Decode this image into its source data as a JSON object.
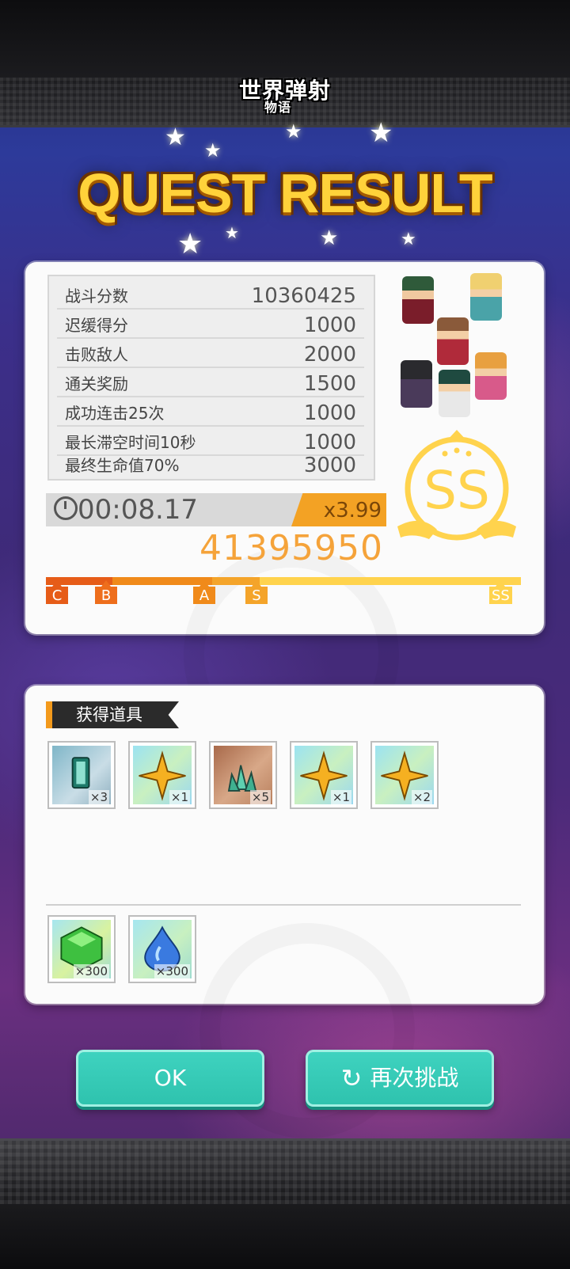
{
  "header": {
    "logo_text": "世界弹射",
    "logo_sub": "物语"
  },
  "title": "QUEST RESULT",
  "result": {
    "rows": [
      {
        "label": "战斗分数",
        "value": "10360425"
      },
      {
        "label": "迟缓得分",
        "value": "1000"
      },
      {
        "label": "击败敌人",
        "value": "2000"
      },
      {
        "label": "通关奖励",
        "value": "1500"
      },
      {
        "label": "成功连击25次",
        "value": "1000"
      },
      {
        "label": "最长滞空时间10秒",
        "value": "1000"
      },
      {
        "label": "最终生命值70%",
        "value": "3000"
      }
    ],
    "time": "00:08.17",
    "multiplier": "x3.99",
    "total": "41395950",
    "rank": "SS",
    "rank_marks": [
      "C",
      "B",
      "A",
      "S",
      "SS"
    ],
    "colors": {
      "orange": "#f3a224",
      "gold": "#ffd34d",
      "red": "#e65c18"
    }
  },
  "items": {
    "header": "获得道具",
    "drops": [
      {
        "icon": "emerald-ticket-icon",
        "count": "×3"
      },
      {
        "icon": "gold-star-icon",
        "count": "×1"
      },
      {
        "icon": "crystal-cluster-icon",
        "count": "×5"
      },
      {
        "icon": "gold-star-icon",
        "count": "×1"
      },
      {
        "icon": "gold-star-icon",
        "count": "×2"
      }
    ],
    "resources": [
      {
        "icon": "green-gem-icon",
        "count": "×300"
      },
      {
        "icon": "blue-droplet-icon",
        "count": "×300"
      }
    ]
  },
  "buttons": {
    "ok": "OK",
    "retry": "再次挑战"
  }
}
